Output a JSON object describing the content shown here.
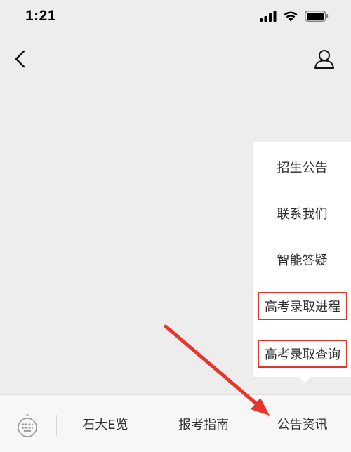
{
  "status_bar": {
    "time": "1:21"
  },
  "menu": {
    "items": [
      {
        "label": "招生公告",
        "highlighted": false
      },
      {
        "label": "联系我们",
        "highlighted": false
      },
      {
        "label": "智能答疑",
        "highlighted": false
      },
      {
        "label": "高考录取进程",
        "highlighted": true
      },
      {
        "label": "高考录取查询",
        "highlighted": true
      }
    ]
  },
  "tab_bar": {
    "tabs": [
      {
        "label": "石大E览"
      },
      {
        "label": "报考指南"
      },
      {
        "label": "公告资讯"
      }
    ]
  },
  "colors": {
    "annotation_red": "#e8342a",
    "highlight_border": "#d8382b",
    "background": "#ededed"
  }
}
